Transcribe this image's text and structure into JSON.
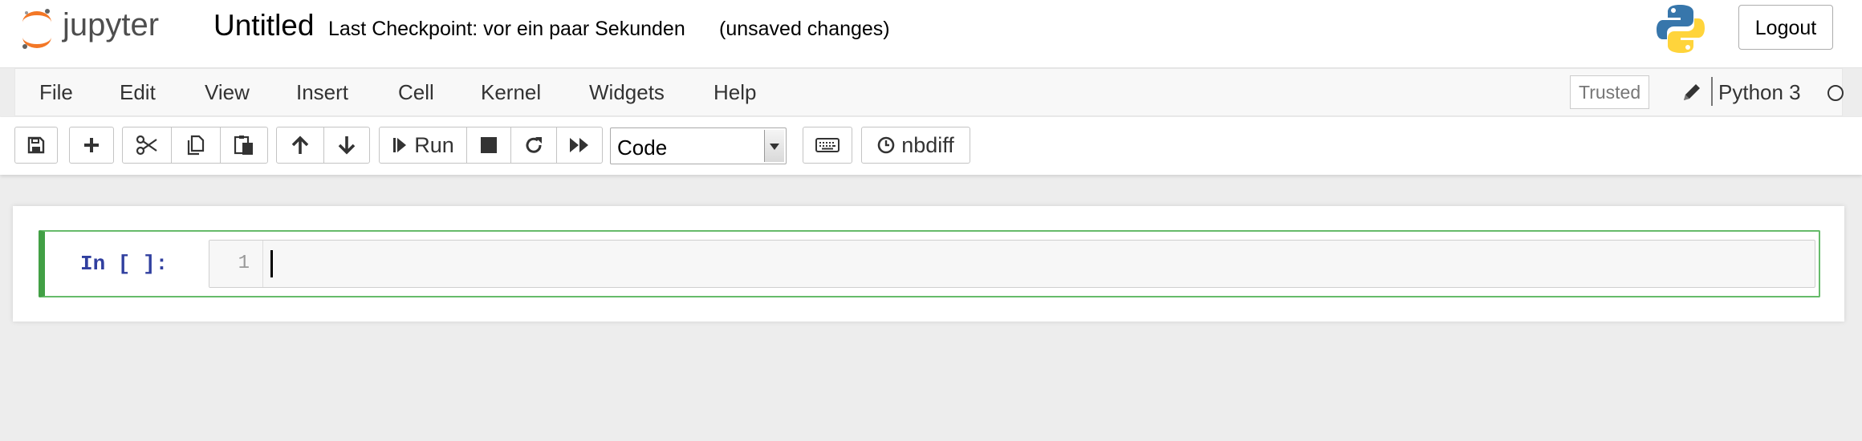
{
  "header": {
    "logo_text": "jupyter",
    "notebook_title": "Untitled",
    "checkpoint": "Last Checkpoint: vor ein paar Sekunden",
    "autosave_status": "(unsaved changes)",
    "logout_label": "Logout"
  },
  "menubar": {
    "items": [
      "File",
      "Edit",
      "View",
      "Insert",
      "Cell",
      "Kernel",
      "Widgets",
      "Help"
    ],
    "trusted_label": "Trusted",
    "kernel_name": "Python 3"
  },
  "toolbar": {
    "buttons": [
      {
        "name": "save-button",
        "icon": "floppy-disk-icon"
      },
      {
        "name": "insert-cell-below-button",
        "icon": "plus-icon"
      },
      {
        "name": "cut-cells-button",
        "icon": "scissors-icon"
      },
      {
        "name": "copy-cells-button",
        "icon": "copy-icon"
      },
      {
        "name": "paste-cells-button",
        "icon": "paste-icon"
      },
      {
        "name": "move-up-button",
        "icon": "arrow-up-icon"
      },
      {
        "name": "move-down-button",
        "icon": "arrow-down-icon"
      },
      {
        "name": "run-button",
        "icon": "step-forward-icon"
      },
      {
        "name": "interrupt-button",
        "icon": "stop-icon"
      },
      {
        "name": "restart-button",
        "icon": "redo-icon"
      },
      {
        "name": "restart-run-all-button",
        "icon": "fast-forward-icon"
      },
      {
        "name": "command-palette-button",
        "icon": "keyboard-icon"
      },
      {
        "name": "nbdiff-button",
        "icon": "clock-icon"
      }
    ],
    "run_label": "Run",
    "cell_type": "Code",
    "nbdiff_label": "nbdiff"
  },
  "cell": {
    "prompt": "In [ ]:",
    "line_number": "1",
    "source": ""
  },
  "colors": {
    "selected_cell_border": "#66bb6a",
    "prompt_color": "#303f9f",
    "jupyter_orange": "#f37726"
  }
}
